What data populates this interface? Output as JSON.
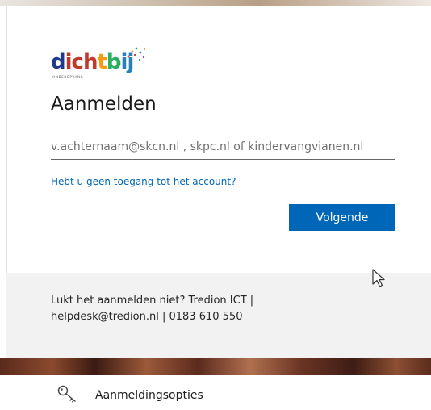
{
  "logo": {
    "brand": "dichtbij",
    "tagline": "KINDEROPVANG",
    "colors": {
      "d": "#1f3a8a",
      "ich": "#c0392b",
      "t": "#f39c12",
      "b": "#27ae60",
      "ij": "#2980b9"
    }
  },
  "signin": {
    "title": "Aanmelden",
    "email_placeholder": "v.achternaam@skcn.nl , skpc.nl of kindervangvianen.nl",
    "help_link": "Hebt u geen toegang tot het account?",
    "next_button": "Volgende"
  },
  "footer": {
    "line1": "Lukt het aanmelden niet? Tredion ICT |",
    "line2": "helpdesk@tredion.nl | 0183 610 550"
  },
  "options": {
    "label": "Aanmeldingsopties",
    "icon": "key-icon"
  },
  "colors": {
    "accent": "#0067b8",
    "footer_bg": "#f2f2f2"
  }
}
